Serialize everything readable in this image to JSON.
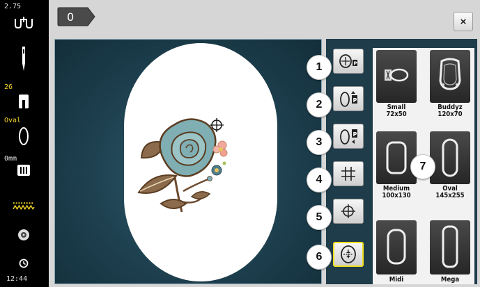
{
  "status": {
    "thread_tension": "2.75",
    "needle_position": "26",
    "hoop_type": "Oval",
    "presser_value": "0mm",
    "time": "12:44"
  },
  "header": {
    "hoop_tab_label": "0",
    "close_label": "×"
  },
  "buttons": [
    {
      "callout": "1",
      "icon": "hoop-center-icon"
    },
    {
      "callout": "2",
      "icon": "hoop-up-icon"
    },
    {
      "callout": "3",
      "icon": "hoop-back-icon"
    },
    {
      "callout": "4",
      "icon": "grid-icon"
    },
    {
      "callout": "5",
      "icon": "crosshair-icon"
    },
    {
      "callout": "6",
      "icon": "hoop-select-icon"
    }
  ],
  "hoops": [
    {
      "name": "Small",
      "size": "72x50"
    },
    {
      "name": "Buddyz",
      "size": "120x70"
    },
    {
      "name": "Medium",
      "size": "100x130"
    },
    {
      "name": "Oval",
      "size": "145x255"
    },
    {
      "name": "Midi",
      "size": ""
    },
    {
      "name": "Mega",
      "size": ""
    }
  ],
  "hoop_callout": "7",
  "colors": {
    "accent_yellow": "#f3d62a",
    "background_blue": "#1d3f4e",
    "active_border": "#f2e01e"
  }
}
